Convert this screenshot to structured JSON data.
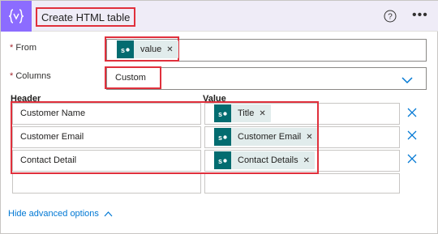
{
  "header": {
    "title": "Create HTML table",
    "icon": "curly-braces-icon",
    "accent": "#8c6cff"
  },
  "from": {
    "label": "From",
    "token": "value"
  },
  "columns": {
    "label": "Columns",
    "value": "Custom"
  },
  "table": {
    "header_label": "Header",
    "value_label": "Value",
    "rows": [
      {
        "header": "Customer Name",
        "value": "Title"
      },
      {
        "header": "Customer Email",
        "value": "Customer Email"
      },
      {
        "header": "Contact Detail",
        "value": "Contact Details"
      }
    ]
  },
  "footer": {
    "advanced_link": "Hide advanced options"
  },
  "colors": {
    "highlight": "#e0303c",
    "token_bg": "#e1ecec",
    "sharepoint": "#036c70",
    "link": "#0078d4"
  }
}
